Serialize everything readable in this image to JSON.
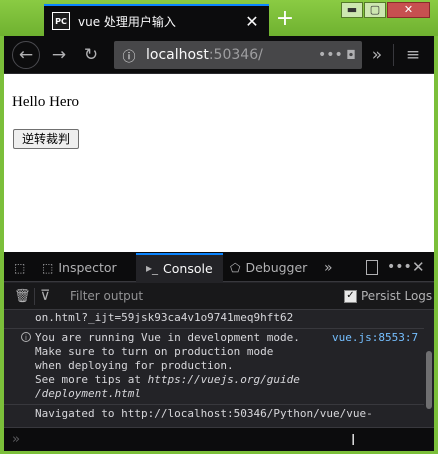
{
  "tab": {
    "favicon": "PC",
    "title": "vue 处理用户输入",
    "close": "✕"
  },
  "window": {
    "new_tab": "+",
    "minimize": "▬",
    "maximize": "▢",
    "close": "✕"
  },
  "nav": {
    "back": "←",
    "forward": "→",
    "reload": "↻",
    "url_info": "ⓘ",
    "url_host": "localhost",
    "url_port": ":50346/",
    "url_more": "•••",
    "pocket": "◘",
    "overflow": "»",
    "menu": "≡"
  },
  "page": {
    "heading": "Hello Hero",
    "button_label": "逆转裁判"
  },
  "devtools": {
    "tabs": [
      {
        "icon": "⬚",
        "label": "Inspector"
      },
      {
        "icon": "▸_",
        "label": "Console"
      },
      {
        "icon": "⬠",
        "label": "Debugger"
      }
    ],
    "more_tabs": "»",
    "dots": "•••",
    "close": "✕",
    "filter_placeholder": "Filter output",
    "persist_label": "Persist Logs",
    "persist_checked": "✓",
    "messages": {
      "m1": "on.html?_ijt=59jsk93ca4v1o9741meq9hft62",
      "m2_l1": "You are running Vue in development mode.",
      "m2_l2": "Make sure to turn on production mode",
      "m2_l3": "when deploying for production.",
      "m2_l4a": "See more tips at ",
      "m2_l4b": "https://vuejs.org/guide",
      "m2_l5": "/deployment.html",
      "m2_source": "vue.js:8553:7",
      "m3_l1": "Navigated to http://localhost:50346/Python/vue/vue-"
    },
    "prompt": "»",
    "caret": "I"
  },
  "colors": {
    "accent": "#0a84ff",
    "link": "#75bfff",
    "desktop": "#7bbf3a"
  }
}
